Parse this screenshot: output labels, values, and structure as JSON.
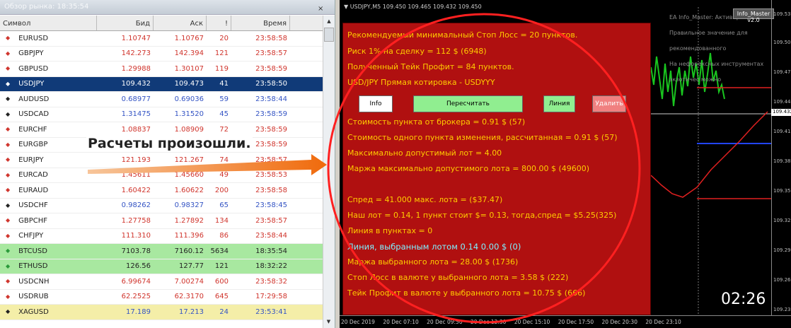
{
  "market_watch": {
    "title": "Обзор рынка: 18:35:54",
    "close_label": "×",
    "headers": [
      "Символ",
      "Бид",
      "Аск",
      "!",
      "Время"
    ],
    "rows": [
      {
        "symbol": "EURUSD",
        "bid": "1.10747",
        "ask": "1.10767",
        "spread": "20",
        "time": "23:58:58",
        "arrow": "◆",
        "style": "normal",
        "color": "r"
      },
      {
        "symbol": "GBPJPY",
        "bid": "142.273",
        "ask": "142.394",
        "spread": "121",
        "time": "23:58:57",
        "arrow": "◆",
        "style": "normal",
        "color": "r"
      },
      {
        "symbol": "GBPUSD",
        "bid": "1.29988",
        "ask": "1.30107",
        "spread": "119",
        "time": "23:58:59",
        "arrow": "◆",
        "style": "normal",
        "color": "r"
      },
      {
        "symbol": "USDJPY",
        "bid": "109.432",
        "ask": "109.473",
        "spread": "41",
        "time": "23:58:50",
        "arrow": "◆",
        "style": "sel",
        "color": "w"
      },
      {
        "symbol": "AUDUSD",
        "bid": "0.68977",
        "ask": "0.69036",
        "spread": "59",
        "time": "23:58:44",
        "arrow": "◆",
        "style": "normal",
        "color": "b"
      },
      {
        "symbol": "USDCAD",
        "bid": "1.31475",
        "ask": "1.31520",
        "spread": "45",
        "time": "23:58:59",
        "arrow": "◆",
        "style": "normal",
        "color": "b"
      },
      {
        "symbol": "EURCHF",
        "bid": "1.08837",
        "ask": "1.08909",
        "spread": "72",
        "time": "23:58:59",
        "arrow": "◆",
        "style": "normal",
        "color": "r"
      },
      {
        "symbol": "EURGBP",
        "bid": "0.85217",
        "ask": "0.85288",
        "spread": "71",
        "time": "23:58:59",
        "arrow": "◆",
        "style": "normal",
        "color": "r"
      },
      {
        "symbol": "EURJPY",
        "bid": "121.193",
        "ask": "121.267",
        "spread": "74",
        "time": "23:58:57",
        "arrow": "◆",
        "style": "normal",
        "color": "r"
      },
      {
        "symbol": "EURCAD",
        "bid": "1.45611",
        "ask": "1.45660",
        "spread": "49",
        "time": "23:58:53",
        "arrow": "◆",
        "style": "normal",
        "color": "r"
      },
      {
        "symbol": "EURAUD",
        "bid": "1.60422",
        "ask": "1.60622",
        "spread": "200",
        "time": "23:58:58",
        "arrow": "◆",
        "style": "normal",
        "color": "r"
      },
      {
        "symbol": "USDCHF",
        "bid": "0.98262",
        "ask": "0.98327",
        "spread": "65",
        "time": "23:58:45",
        "arrow": "◆",
        "style": "normal",
        "color": "b"
      },
      {
        "symbol": "GBPCHF",
        "bid": "1.27758",
        "ask": "1.27892",
        "spread": "134",
        "time": "23:58:57",
        "arrow": "◆",
        "style": "normal",
        "color": "r"
      },
      {
        "symbol": "CHFJPY",
        "bid": "111.310",
        "ask": "111.396",
        "spread": "86",
        "time": "23:58:44",
        "arrow": "◆",
        "style": "normal",
        "color": "r"
      },
      {
        "symbol": "BTCUSD",
        "bid": "7103.78",
        "ask": "7160.12",
        "spread": "5634",
        "time": "18:35:54",
        "arrow": "◆",
        "style": "gr",
        "color": "g"
      },
      {
        "symbol": "ETHUSD",
        "bid": "126.56",
        "ask": "127.77",
        "spread": "121",
        "time": "18:32:22",
        "arrow": "◆",
        "style": "gr",
        "color": "g"
      },
      {
        "symbol": "USDCNH",
        "bid": "6.99674",
        "ask": "7.00274",
        "spread": "600",
        "time": "23:58:32",
        "arrow": "◆",
        "style": "normal",
        "color": "r"
      },
      {
        "symbol": "USDRUB",
        "bid": "62.2525",
        "ask": "62.3170",
        "spread": "645",
        "time": "17:29:58",
        "arrow": "◆",
        "style": "normal",
        "color": "r"
      },
      {
        "symbol": "XAGUSD",
        "bid": "17.189",
        "ask": "17.213",
        "spread": "24",
        "time": "23:53:41",
        "arrow": "◆",
        "style": "yl",
        "color": "g"
      }
    ]
  },
  "overlay_label": "Расчеты произошли.",
  "chart": {
    "title": "▼ USDJPY,M5  109.450 109.465 109.432 109.450",
    "ea_button": "Info_Master v2.0",
    "ea_info": [
      "EA Info_Master: Активированный",
      "Правильное значение для рекомендованного",
      "На нефорексных инструментах экзотичес можно"
    ],
    "price_labels": [
      "109.535",
      "109.505",
      "109.475",
      "109.445",
      "109.432",
      "109.415",
      "109.385",
      "109.355",
      "109.325",
      "109.295",
      "109.265",
      "109.235"
    ],
    "time_labels": [
      "20 Dec 2019",
      "20 Dec 07:10",
      "20 Dec 09:50",
      "20 Dec 12:30",
      "20 Dec 15:10",
      "20 Dec 17:50",
      "20 Dec 20:30",
      "20 Dec 23:10"
    ],
    "clock": "02:26"
  },
  "panel": {
    "lines": [
      "Рекомендуемый минимальный Стоп Лосс  = 20 пунктов.",
      "Риск 1% на сделку  = 112 $ (6948)",
      "Полученный Тейк Профит  = 84 пунктов.",
      "USD/JPY Прямая котировка - USDYYY",
      "Стоимость пункта от брокера  = 0.91 $ (57)",
      "Стоимость одного пункта изменения, рассчитанная = 0.91 $ (57)",
      "Максимально допустимый лот  = 4.00",
      "Маржа максимально допустимого лота = 800.00 $ (49600)",
      "Спред  = 41.000 макс. лота = ($37.47)",
      "Наш лот = 0.14, 1 пункт стоит $= 0.13, тогда,спред = $5.25(325)",
      "Линия в пунктах  = 0",
      "Линия, выбранным лотом 0.14  0.00 $ (0)",
      "Маржа выбранного лота = 28.00 $ (1736)",
      "Стоп Лосс в валюте у выбранного лота = 3.58 $ (222)",
      "Тейк Профит в валюте у выбранного лота = 10.75 $ (666)"
    ],
    "buttons": {
      "info": "Info",
      "recalc": "Пересчитать",
      "line": "Линия",
      "delete": "Удалить"
    }
  }
}
